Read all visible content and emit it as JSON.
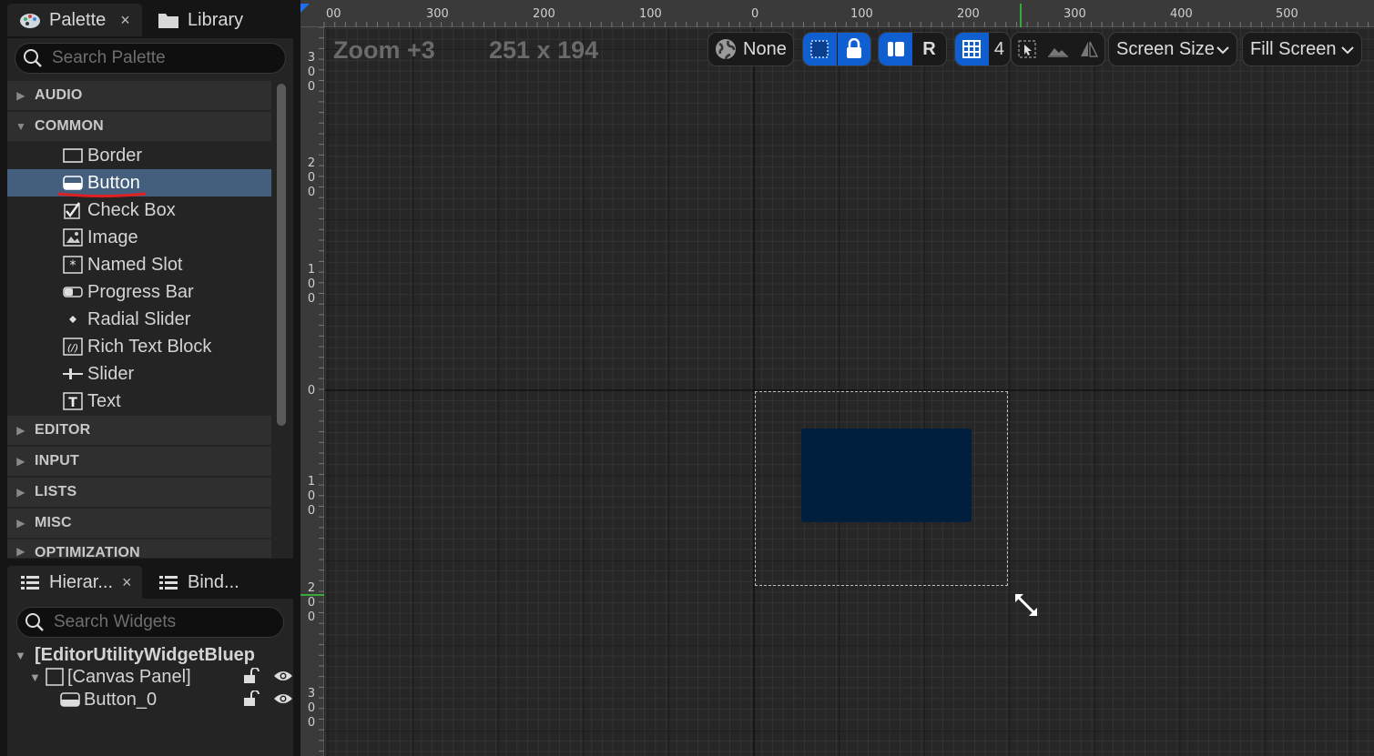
{
  "palette": {
    "tab_label": "Palette",
    "close_glyph": "×",
    "library_tab_label": "Library",
    "search_placeholder": "Search Palette",
    "categories": [
      {
        "label": "AUDIO",
        "expanded": false
      },
      {
        "label": "COMMON",
        "expanded": true
      },
      {
        "label": "EDITOR",
        "expanded": false
      },
      {
        "label": "INPUT",
        "expanded": false
      },
      {
        "label": "LISTS",
        "expanded": false
      },
      {
        "label": "MISC",
        "expanded": false
      },
      {
        "label": "OPTIMIZATION",
        "expanded": false
      }
    ],
    "common_items": [
      {
        "label": "Border",
        "icon": "border-icon"
      },
      {
        "label": "Button",
        "icon": "button-icon",
        "selected": true
      },
      {
        "label": "Check Box",
        "icon": "checkbox-icon"
      },
      {
        "label": "Image",
        "icon": "image-icon"
      },
      {
        "label": "Named Slot",
        "icon": "named-slot-icon"
      },
      {
        "label": "Progress Bar",
        "icon": "progress-bar-icon"
      },
      {
        "label": "Radial Slider",
        "icon": "radial-slider-icon"
      },
      {
        "label": "Rich Text Block",
        "icon": "rich-text-icon"
      },
      {
        "label": "Slider",
        "icon": "slider-icon"
      },
      {
        "label": "Text",
        "icon": "text-icon"
      }
    ]
  },
  "hierarchy": {
    "tab_label": "Hierar...",
    "close_glyph": "×",
    "bind_tab_label": "Bind...",
    "search_placeholder": "Search Widgets",
    "root_label": "[EditorUtilityWidgetBluep",
    "canvas_label": "[Canvas Panel]",
    "button_label": "Button_0"
  },
  "designer": {
    "zoom_label": "Zoom +3",
    "size_label": "251 x 194",
    "toolbar": {
      "localization_label": "None",
      "r_label": "R",
      "grid_snap_value": "4",
      "screen_size_label": "Screen Size",
      "fill_screen_label": "Fill Screen"
    },
    "ruler_top_labels": [
      "00",
      "300",
      "200",
      "100",
      "0",
      "100",
      "200",
      "300",
      "400",
      "500"
    ],
    "ruler_left_labels": [
      "300",
      "200",
      "100",
      "0",
      "100",
      "200",
      "300"
    ],
    "colors": {
      "accent_blue": "#0f5fd0",
      "selected_row": "#445e7e",
      "button_fill": "#001f3f",
      "annotation_red": "#e02020"
    }
  }
}
